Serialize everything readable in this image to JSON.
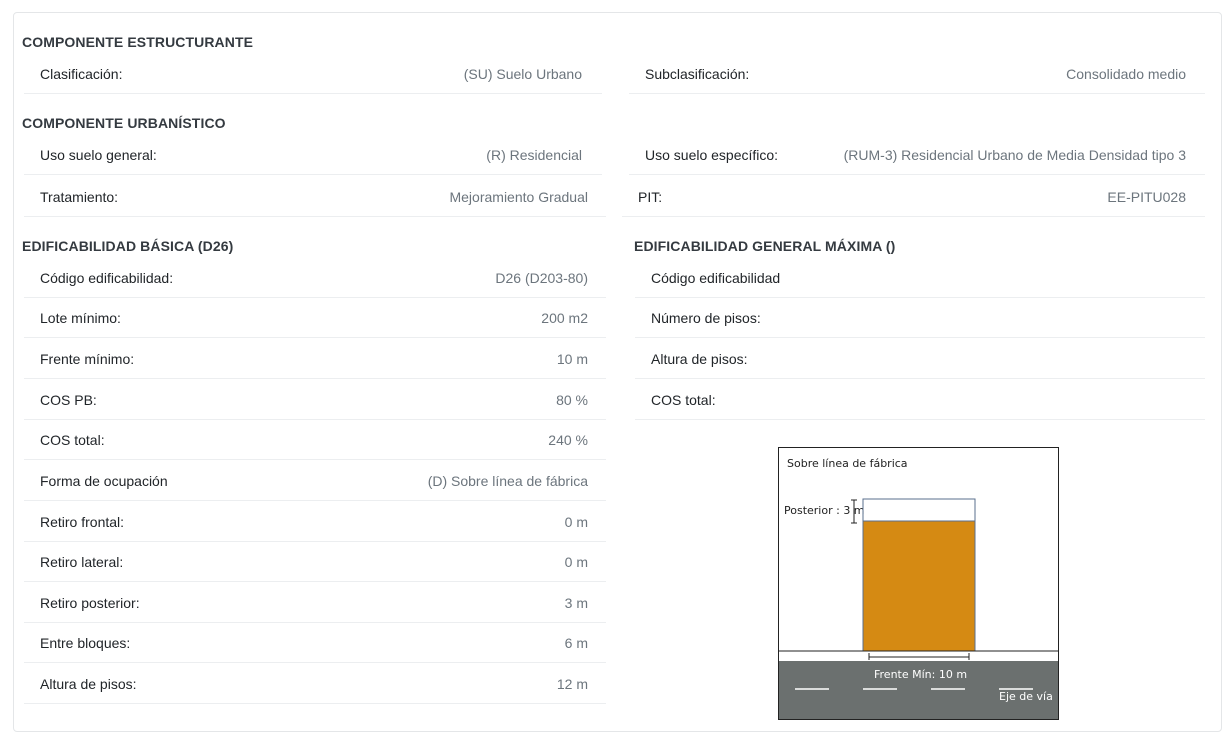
{
  "estructurante": {
    "title": "COMPONENTE ESTRUCTURANTE",
    "clasificacion": {
      "label": "Clasificación:",
      "value": "(SU) Suelo Urbano"
    },
    "subclasificacion": {
      "label": "Subclasificación:",
      "value": "Consolidado medio"
    }
  },
  "urbanistico": {
    "title": "COMPONENTE URBANÍSTICO",
    "uso_general": {
      "label": "Uso suelo general:",
      "value": "(R) Residencial"
    },
    "uso_especifico": {
      "label": "Uso suelo específico:",
      "value": "(RUM-3) Residencial Urbano de Media Densidad tipo 3"
    },
    "tratamiento": {
      "label": "Tratamiento:",
      "value": "Mejoramiento Gradual"
    },
    "pit": {
      "label": "PIT:",
      "value": "EE-PITU028"
    }
  },
  "basica": {
    "title": "EDIFICABILIDAD BÁSICA (D26)",
    "rows": [
      {
        "label": "Código edificabilidad:",
        "value": "D26 (D203-80)"
      },
      {
        "label": "Lote mínimo:",
        "value": "200 m2"
      },
      {
        "label": "Frente mínimo:",
        "value": "10 m"
      },
      {
        "label": "COS PB:",
        "value": "80 %"
      },
      {
        "label": "COS total:",
        "value": "240 %"
      },
      {
        "label": "Forma de ocupación",
        "value": "(D) Sobre línea de fábrica"
      },
      {
        "label": "Retiro frontal:",
        "value": "0 m"
      },
      {
        "label": "Retiro lateral:",
        "value": "0 m"
      },
      {
        "label": "Retiro posterior:",
        "value": "3 m"
      },
      {
        "label": "Entre bloques:",
        "value": "6 m"
      },
      {
        "label": "Altura de pisos:",
        "value": "12 m"
      }
    ]
  },
  "maxima": {
    "title": "EDIFICABILIDAD GENERAL MÁXIMA ()",
    "rows": [
      {
        "label": "Código edificabilidad",
        "value": ""
      },
      {
        "label": "Número de pisos:",
        "value": ""
      },
      {
        "label": "Altura de pisos:",
        "value": ""
      },
      {
        "label": "COS total:",
        "value": ""
      }
    ]
  },
  "diagram": {
    "title": "Sobre línea de fábrica",
    "posterior": "Posterior : 3 m",
    "frente": "Frente Mín: 10 m",
    "eje": "Eje de vía",
    "colors": {
      "building": "#d58a13",
      "road": "#6b706f",
      "line": "#222222"
    }
  }
}
